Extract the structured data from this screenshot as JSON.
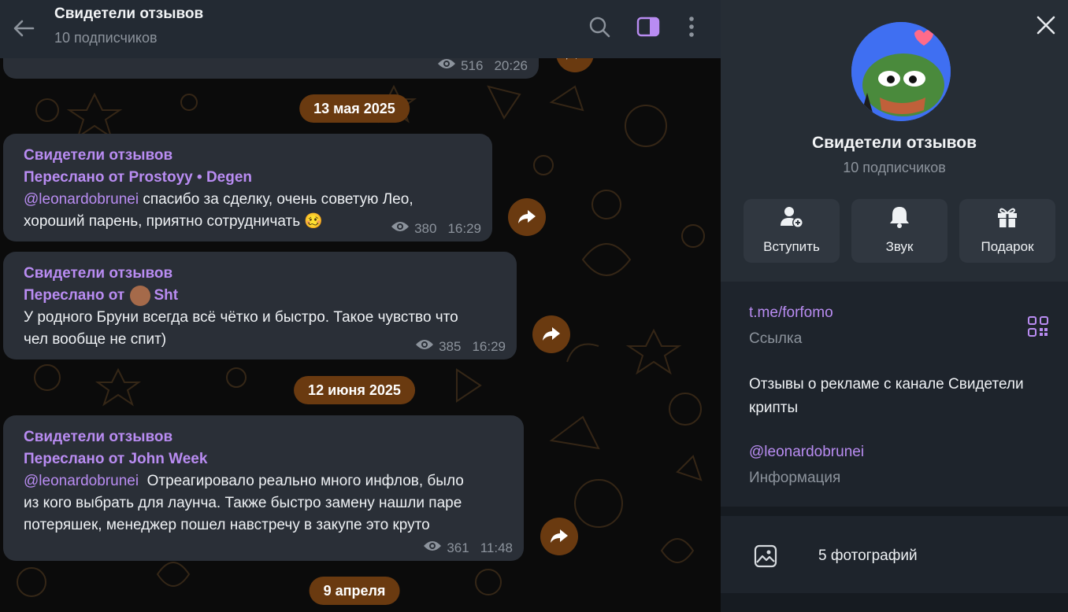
{
  "header": {
    "title": "Свидетели отзывов",
    "subtitle": "10 подписчиков"
  },
  "top_message": {
    "views": "516",
    "time": "20:26"
  },
  "dates": [
    "13 мая 2025",
    "12 июня 2025",
    "9 апреля"
  ],
  "messages": [
    {
      "author": "Свидетели отзывов",
      "fwd_prefix": "Переслано от ",
      "fwd_name": "Prostoyy • Degen",
      "mention": "@leonardobrunei",
      "text_line1": " спасибо за сделку, очень советую Лео,",
      "text_line2": "хороший парень, приятно сотрудничать",
      "emoji": "🥴",
      "views": "380",
      "time": "16:29"
    },
    {
      "author": "Свидетели отзывов",
      "fwd_prefix": "Переслано от ",
      "fwd_name": "Sht",
      "text_line1": "У родного Бруни всегда всё чётко и быстро. Такое чувство что",
      "text_line2": "чел вообще не спит)",
      "views": "385",
      "time": "16:29"
    },
    {
      "author": "Свидетели отзывов",
      "fwd_prefix": "Переслано от ",
      "fwd_name": "John Week",
      "mention": "@leonardobrunei",
      "text_line1": "  Отреагировало реально много инфлов, было",
      "text_line2": "из кого выбрать для лаунча. Также быстро замену нашли паре",
      "text_line3": "потеряшек, менеджер пошел навстречу в закупе это круто",
      "views": "361",
      "time": "11:48"
    }
  ],
  "panel": {
    "name": "Свидетели отзывов",
    "subtitle": "10 подписчиков",
    "actions": [
      {
        "label": "Вступить",
        "icon": "user-plus-icon"
      },
      {
        "label": "Звук",
        "icon": "bell-icon"
      },
      {
        "label": "Подарок",
        "icon": "gift-icon"
      }
    ],
    "link": "t.me/forfomo",
    "link_caption": "Ссылка",
    "description": "Отзывы о рекламе с канале Свидетели крипты",
    "info_mention": "@leonardobrunei",
    "info_caption": "Информация",
    "photos_label": "5 фотографий"
  },
  "colors": {
    "accent": "#b98cf2",
    "bubble": "#2a2f37",
    "header": "#232a33",
    "date_pill": "#6a3a10",
    "panel": "#1e242c"
  }
}
